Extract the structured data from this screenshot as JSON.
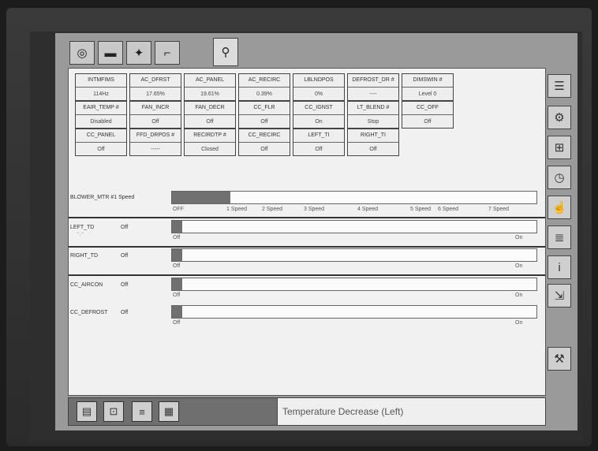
{
  "tabs": [
    {
      "icon": "gauge-icon",
      "glyph": "◎"
    },
    {
      "icon": "car-icon",
      "glyph": "▬"
    },
    {
      "icon": "engine-icon",
      "glyph": "✦"
    },
    {
      "icon": "probe-icon",
      "glyph": "⌐"
    },
    {
      "icon": "magnifier-icon",
      "glyph": "⚲"
    }
  ],
  "pids": [
    {
      "name": "INTMFIMS",
      "value": "114Hz"
    },
    {
      "name": "AC_DFRST",
      "value": "17.65%"
    },
    {
      "name": "AC_PANEL",
      "value": "19.61%"
    },
    {
      "name": "AC_RECIRC",
      "value": "0.39%"
    },
    {
      "name": "LBLNDPOS",
      "value": "0%"
    },
    {
      "name": "DEFROST_DR #",
      "value": "----"
    },
    {
      "name": "DIMSWIN #",
      "value": "Level 0"
    },
    {
      "name": "EAIR_TEMP #",
      "value": "Disabled"
    },
    {
      "name": "FAN_INCR",
      "value": "Off"
    },
    {
      "name": "FAN_DECR",
      "value": "Off"
    },
    {
      "name": "CC_FLR",
      "value": "Off"
    },
    {
      "name": "CC_IGNST",
      "value": "On"
    },
    {
      "name": "LT_BLEND #",
      "value": "Stop"
    },
    {
      "name": "CC_OFF",
      "value": "Off"
    },
    {
      "name": "CC_PANEL",
      "value": "Off"
    },
    {
      "name": "FFD_DRPOS #",
      "value": "-----"
    },
    {
      "name": "RECIRDTP #",
      "value": "Closed"
    },
    {
      "name": "CC_RECIRC",
      "value": "Off"
    },
    {
      "name": "LEFT_TI",
      "value": "Off"
    },
    {
      "name": "RIGHT_TI",
      "value": "Off"
    }
  ],
  "blower": {
    "label": "BLOWER_MTR #1 Speed",
    "level": 0.16,
    "ticks": [
      "OFF",
      "1 Speed",
      "2 Speed",
      "3 Speed",
      "4 Speed",
      "5 Speed",
      "6 Speed",
      "7 Speed"
    ]
  },
  "outputs": [
    {
      "label": "LEFT_TD",
      "state": "Off",
      "sub": "⁻.⁻",
      "min": "Off",
      "max": "On",
      "level": 0
    },
    {
      "label": "RIGHT_TD",
      "state": "Off",
      "sub": "",
      "min": "Off",
      "max": "On",
      "level": 0
    },
    {
      "label": "CC_AIRCON",
      "state": "Off",
      "sub": "",
      "min": "Off",
      "max": "On",
      "level": 0
    },
    {
      "label": "CC_DEFROST",
      "state": "Off",
      "sub": "",
      "min": "Off",
      "max": "On",
      "level": 0
    }
  ],
  "side_buttons": [
    {
      "icon": "list-icon",
      "glyph": "☰"
    },
    {
      "icon": "camera-icon",
      "glyph": "⚙"
    },
    {
      "icon": "graph-icon",
      "glyph": "⊞"
    },
    {
      "icon": "stopwatch-icon",
      "glyph": "◷"
    },
    {
      "icon": "hand-select-icon",
      "glyph": "☝"
    },
    {
      "icon": "rows-icon",
      "glyph": "≣"
    },
    {
      "icon": "info-icon",
      "glyph": "i"
    },
    {
      "icon": "export-icon",
      "glyph": "⇲"
    },
    {
      "icon": "tools-icon",
      "glyph": "⚒"
    }
  ],
  "bottom_buttons": [
    {
      "icon": "page-icon",
      "glyph": "▤"
    },
    {
      "icon": "zoom-icon",
      "glyph": "⊡"
    },
    {
      "icon": "text-view-icon",
      "glyph": "≡"
    },
    {
      "icon": "table-view-icon",
      "glyph": "▦"
    }
  ],
  "status": "Temperature Decrease (Left)"
}
